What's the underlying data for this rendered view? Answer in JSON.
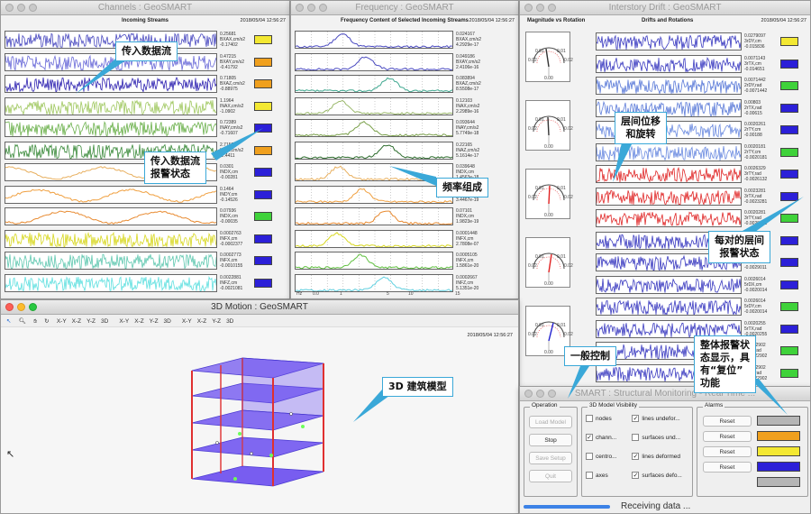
{
  "channels": {
    "title": "Channels : GeoSMART",
    "header": "Incoming Streams",
    "timestamp": "2018/05/04 12:56:27",
    "rows": [
      {
        "v1": "0.25681",
        "unit": "BXAX,cm/s2",
        "v2": "-0.17402",
        "alarm": "#f3e832"
      },
      {
        "v1": "0.47215",
        "unit": "BXAY,cm/s2",
        "v2": "-0.41792",
        "alarm": "#f0a01e"
      },
      {
        "v1": "0.71805",
        "unit": "BXAZ,cm/s2",
        "v2": "-0.88975",
        "alarm": "#f0a01e"
      },
      {
        "v1": "1.1964",
        "unit": "INAX,cm/s2",
        "v2": "-1.0902",
        "alarm": "#f3e832"
      },
      {
        "v1": "0.72389",
        "unit": "INAY,cm/s2",
        "v2": "-0.71607",
        "alarm": "#2c20d8"
      },
      {
        "v1": "2.7152",
        "unit": "INAZ,cm/s2",
        "v2": "-2.4411",
        "alarm": "#f0a01e"
      },
      {
        "v1": "0.0301",
        "unit": "INDX,cm",
        "v2": "-0.00281",
        "alarm": "#2c20d8"
      },
      {
        "v1": "0.1464",
        "unit": "INDY,cm",
        "v2": "-0.14526",
        "alarm": "#2c20d8"
      },
      {
        "v1": "0.07936",
        "unit": "INDX,cm",
        "v2": "-0.00035",
        "alarm": "#3fd23a"
      },
      {
        "v1": "0.0002763",
        "unit": "INFX,cm",
        "v2": "-0.0002377",
        "alarm": "#2c20d8"
      },
      {
        "v1": "0.0002773",
        "unit": "INFX,cm",
        "v2": "-0.0010155",
        "alarm": "#2c20d8"
      },
      {
        "v1": "0.0022881",
        "unit": "INFZ,cm",
        "v2": "-0.0021081",
        "alarm": "#2c20d8"
      }
    ]
  },
  "frequency": {
    "title": "Frequency : GeoSMART",
    "header": "Frequency Content of Selected Incoming Streams",
    "timestamp": "2018/05/04 12:56:27",
    "rows": [
      {
        "v1": "0.024167",
        "unit": "BXAX,cm/s2",
        "v2": "4.2929e-17"
      },
      {
        "v1": "0.049186",
        "unit": "BXAY,cm/s2",
        "v2": "2.4106e-16"
      },
      {
        "v1": "0.083894",
        "unit": "BXAZ,cm/s2",
        "v2": "8.5508e-17"
      },
      {
        "v1": "0.12103",
        "unit": "INAX,cm/s2",
        "v2": "2.2989e-16"
      },
      {
        "v1": "0.093644",
        "unit": "INAY,cm/s2",
        "v2": "5.7749e-18"
      },
      {
        "v1": "0.22165",
        "unit": "INAZ,cm/s2",
        "v2": "5.1614e-17"
      },
      {
        "v1": "0.039648",
        "unit": "INDX,cm",
        "v2": "1.4563e-18"
      },
      {
        "v1": "0.0048",
        "unit": "INDY,cm",
        "v2": "3.4467e-19"
      },
      {
        "v1": "0.07101",
        "unit": "INDX,cm",
        "v2": "1.9823e-19"
      },
      {
        "v1": "0.0001448",
        "unit": "INFX,cm",
        "v2": "2.7808e-07"
      },
      {
        "v1": "0.0005105",
        "unit": "INFX,cm",
        "v2": "1.5861e-20"
      },
      {
        "v1": "0.0002667",
        "unit": "INFZ,cm",
        "v2": "5.1351e-20"
      }
    ],
    "axis": [
      "Hz",
      "0.0",
      "1",
      "5",
      "10",
      "15"
    ]
  },
  "drift": {
    "title": "Interstory Drift : GeoSMART",
    "header_left": "Magnitude vs Rotation",
    "header_right": "Drifts and Rotations",
    "timestamp": "2018/05/04 12:56:27",
    "gauge_labels": [
      "0.02",
      "0.01",
      "0.01",
      "0.02"
    ],
    "gauge_base": "0.00",
    "rows": [
      {
        "v1": "0.0279097",
        "unit": "3rDY,cm",
        "v2": "-0.015836",
        "alarm": "#f3e832"
      },
      {
        "v1": "0.0071143",
        "unit": "3rTX,cm",
        "v2": "-0.014651",
        "alarm": "#2c20d8"
      },
      {
        "v1": "0.0071442",
        "unit": "2rDY,rad",
        "v2": "-0.0071442",
        "alarm": "#3fd23a"
      },
      {
        "v1": "0.00803",
        "unit": "2rTX,rad",
        "v2": "-0.00615",
        "alarm": "#2c20d8"
      },
      {
        "v1": "0.0020261",
        "unit": "2rTY,cm",
        "v2": "-0.00188",
        "alarm": "#2c20d8"
      },
      {
        "v1": "0.0020181",
        "unit": "2rTY,cm",
        "v2": "-0.0020181",
        "alarm": "#3fd23a"
      },
      {
        "v1": "0.0026329",
        "unit": "3rTY,rad",
        "v2": "-0.0026132",
        "alarm": "#2c20d8"
      },
      {
        "v1": "0.0023281",
        "unit": "3rTX,rad",
        "v2": "-0.0023281",
        "alarm": "#2c20d8"
      },
      {
        "v1": "0.0020281",
        "unit": "3rTY,rad",
        "v2": "-0.0020281",
        "alarm": "#3fd23a"
      },
      {
        "v1": "0.0026101",
        "unit": "4rDX,cm",
        "v2": "-0.0025101",
        "alarm": "#2c20d8"
      },
      {
        "v1": "0.0029011",
        "unit": "4rDY,cm",
        "v2": "-0.0029011",
        "alarm": "#2c20d8"
      },
      {
        "v1": "0.0026014",
        "unit": "5rDX,cm",
        "v2": "-0.0020014",
        "alarm": "#2c20d8"
      },
      {
        "v1": "0.0026014",
        "unit": "5rDY,cm",
        "v2": "-0.0020014",
        "alarm": "#3fd23a"
      },
      {
        "v1": "0.0020255",
        "unit": "5rTX,rad",
        "v2": "-0.0020255",
        "alarm": "#2c20d8"
      },
      {
        "v1": "0.0022902",
        "unit": "5rTY,rad",
        "v2": "-0.0022902",
        "alarm": "#3fd23a"
      },
      {
        "v1": "0.0022902",
        "unit": "5rTZ,rad",
        "v2": "-0.0022902",
        "alarm": "#3fd23a"
      }
    ]
  },
  "motion": {
    "title": "3D Motion : GeoSMART",
    "timestamp": "2018/05/04 12:56:27",
    "tools1": [
      "X-Y",
      "X-Z",
      "Y-Z",
      "3D"
    ],
    "tools2": [
      "X-Y",
      "X-Z",
      "Y-Z",
      "3D"
    ],
    "tools3": [
      "X-Y",
      "X-Z",
      "Y-Z",
      "3D"
    ]
  },
  "control": {
    "title": "SMART : Structural Monitoring - Real Time ...",
    "operation_label": "Operation",
    "operation_buttons": [
      "Load Model",
      "Stop",
      "Save Setup",
      "Quit"
    ],
    "visibility_label": "3D Model Visibility",
    "vis_left": [
      {
        "label": "nodes",
        "checked": false
      },
      {
        "label": "chann...",
        "checked": true
      },
      {
        "label": "centro...",
        "checked": false
      },
      {
        "label": "axes",
        "checked": false
      }
    ],
    "vis_right": [
      {
        "label": "lines undefor...",
        "checked": true
      },
      {
        "label": "surfaces und...",
        "checked": false
      },
      {
        "label": "lines deformed",
        "checked": true
      },
      {
        "label": "surfaces defo...",
        "checked": true
      }
    ],
    "alarms_label": "Alarms",
    "reset_label": "Reset",
    "alarm_colors": [
      "#b5b5b5",
      "#f0a01e",
      "#f3e832",
      "#2c20d8",
      "#b5b5b5"
    ],
    "status": "Receiving data ..."
  },
  "callouts": {
    "incoming": "传入数据流",
    "incoming_alarm": "传入数据流\n报警状态",
    "frequency": "频率组成",
    "drift": "层间位移\n和旋转",
    "drift_alarm": "每对的层间\n报警状态",
    "control": "一般控制",
    "overall": "整体报警状\n态显示，具\n有“复位”\n功能",
    "model": "3D 建筑模型"
  }
}
